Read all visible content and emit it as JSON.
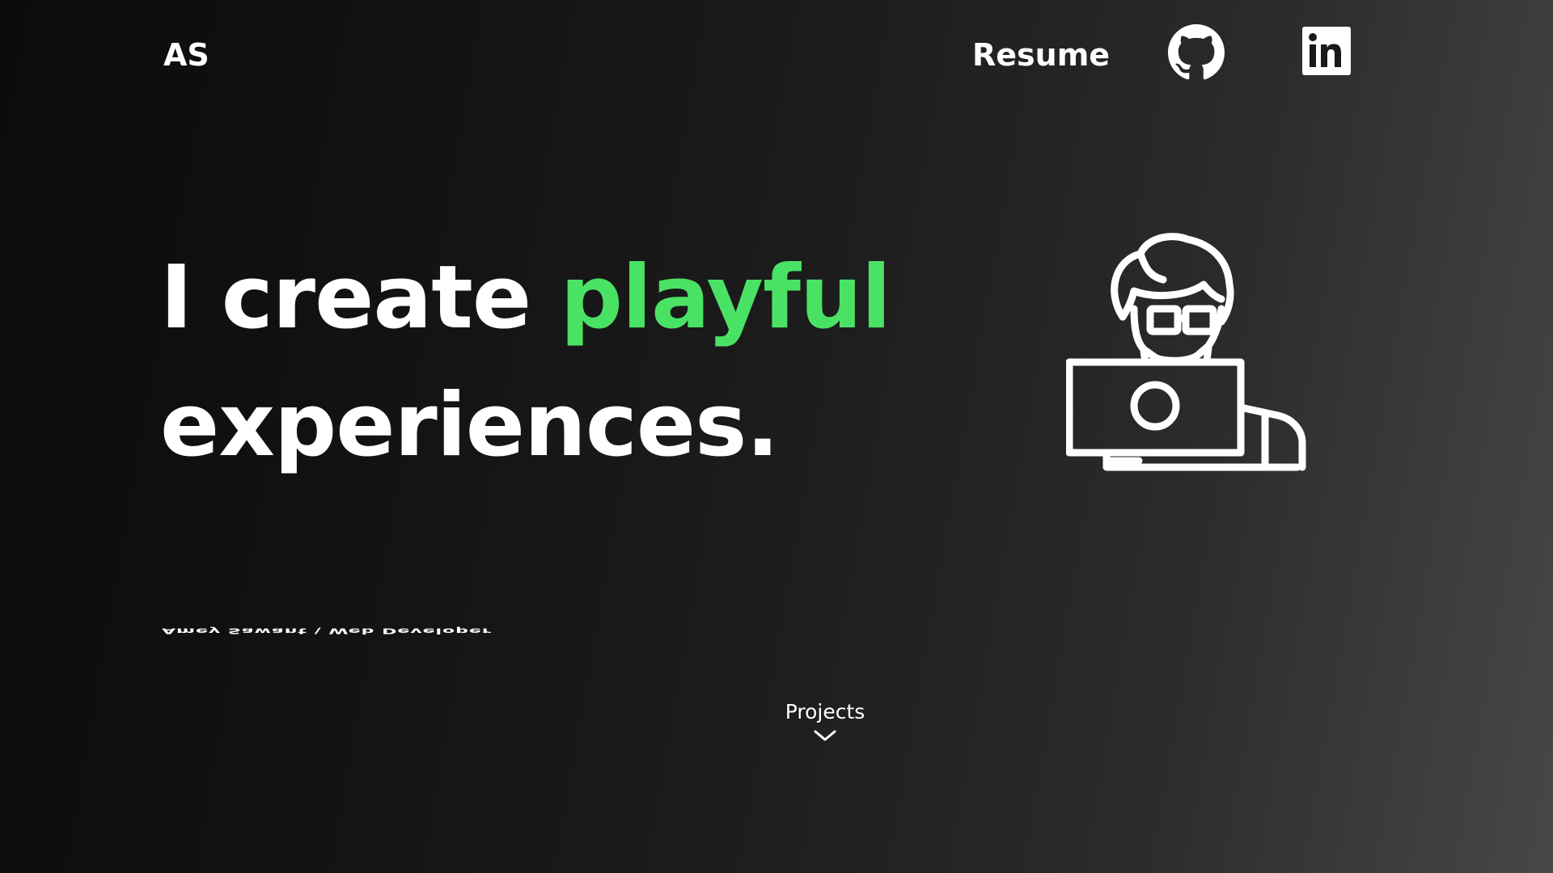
{
  "header": {
    "logo": "AS",
    "nav": {
      "resume_label": "Resume",
      "github_icon": "github-icon",
      "linkedin_icon": "linkedin-icon"
    }
  },
  "hero": {
    "headline_line1_start": "I create ",
    "headline_accent": "playful",
    "headline_line2": "experiences.",
    "accent_color": "#4ae265",
    "illustration_icon": "developer-at-computer-icon",
    "subtitle": "Amey Sawant \\ Web Developer"
  },
  "scroll_cta": {
    "label": "Projects",
    "icon": "chevron-down-icon"
  }
}
